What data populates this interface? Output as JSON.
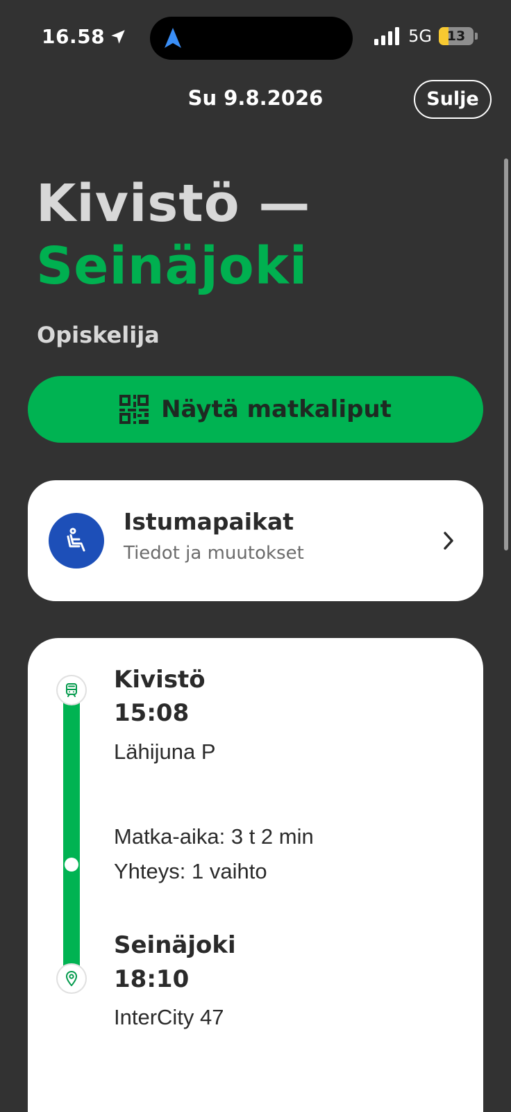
{
  "status_bar": {
    "time": "16.58",
    "network": "5G",
    "battery_level": "13",
    "battery_fraction": 0.13,
    "location_icon": "location-arrow-icon",
    "navigation_icon": "navigation-arrow-icon"
  },
  "header": {
    "date": "Su 9.8.2026",
    "close_label": "Sulje"
  },
  "trip": {
    "from_title": "Kivistö —",
    "to_title": "Seinäjoki",
    "passenger_type": "Opiskelija"
  },
  "tickets_button": {
    "label": "Näytä matkaliput",
    "icon": "qr-code-icon"
  },
  "seats_card": {
    "title": "Istumapaikat",
    "subtitle": "Tiedot ja muutokset",
    "icon": "seat-icon"
  },
  "itinerary": {
    "departure": {
      "station": "Kivistö",
      "time": "15:08",
      "train": "Lähijuna P",
      "icon": "train-icon"
    },
    "duration": "Matka-aika: 3 t 2 min",
    "connections": "Yhteys: 1 vaihto",
    "arrival": {
      "station": "Seinäjoki",
      "time": "18:10",
      "train": "InterCity 47",
      "icon": "destination-pin-icon"
    }
  },
  "colors": {
    "background": "#323232",
    "accent_green": "#00b352",
    "seat_blue": "#1d4fb8",
    "card": "#ffffff"
  }
}
